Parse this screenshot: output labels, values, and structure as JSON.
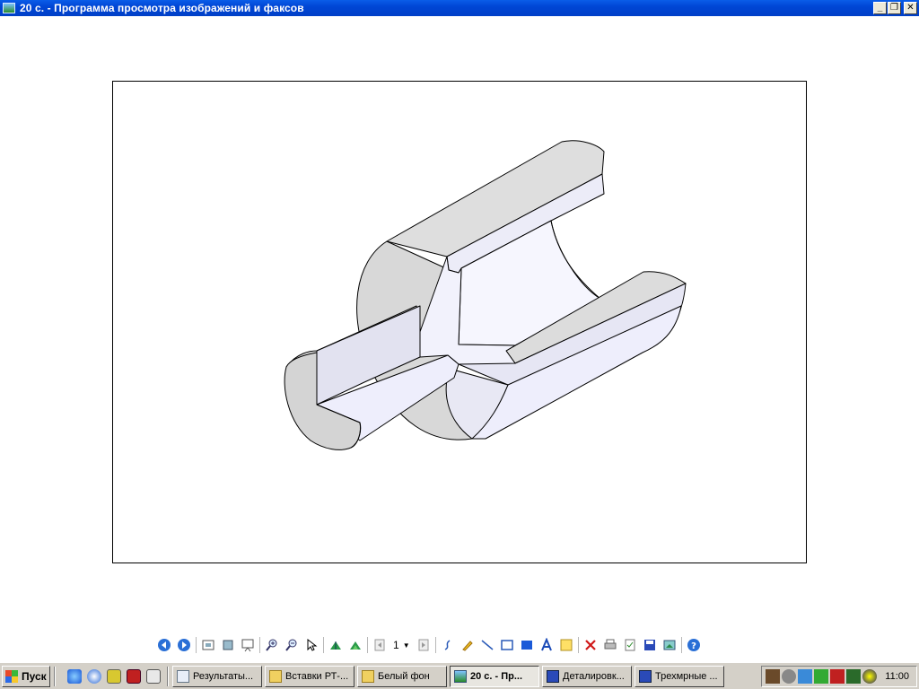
{
  "window": {
    "title": "20 с. - Программа просмотра изображений и факсов",
    "buttons": {
      "minimize": "_",
      "maximize": "❐",
      "close": "✕"
    }
  },
  "toolbar": {
    "page_number": "1",
    "icons": [
      "previous-image-icon",
      "next-image-icon",
      "best-fit-icon",
      "actual-size-icon",
      "slideshow-icon",
      "zoom-in-icon",
      "zoom-out-icon",
      "pointer-icon",
      "rotate-clockwise-icon",
      "rotate-counterclockwise-icon",
      "previous-page-icon",
      "next-page-icon",
      "freehand-icon",
      "highlight-icon",
      "line-icon",
      "frame-icon",
      "filled-rectangle-icon",
      "text-icon",
      "note-icon",
      "delete-icon",
      "print-icon",
      "copy-to-icon",
      "save-icon",
      "edit-icon",
      "help-icon"
    ]
  },
  "taskbar": {
    "start_label": "Пуск",
    "tasks": [
      {
        "label": "Результаты..."
      },
      {
        "label": "Вставки РТ-..."
      },
      {
        "label": "Белый фон"
      },
      {
        "label": "20 с. - Пр...",
        "active": true
      },
      {
        "label": "Деталировк..."
      },
      {
        "label": "Трехмрные ..."
      }
    ],
    "clock": "11:00"
  },
  "colors": {
    "titlebar": "#0046d5",
    "taskbar": "#d4d0c8",
    "shaded_face": "#dcdcdc",
    "lit_face": "#eeeefc"
  }
}
